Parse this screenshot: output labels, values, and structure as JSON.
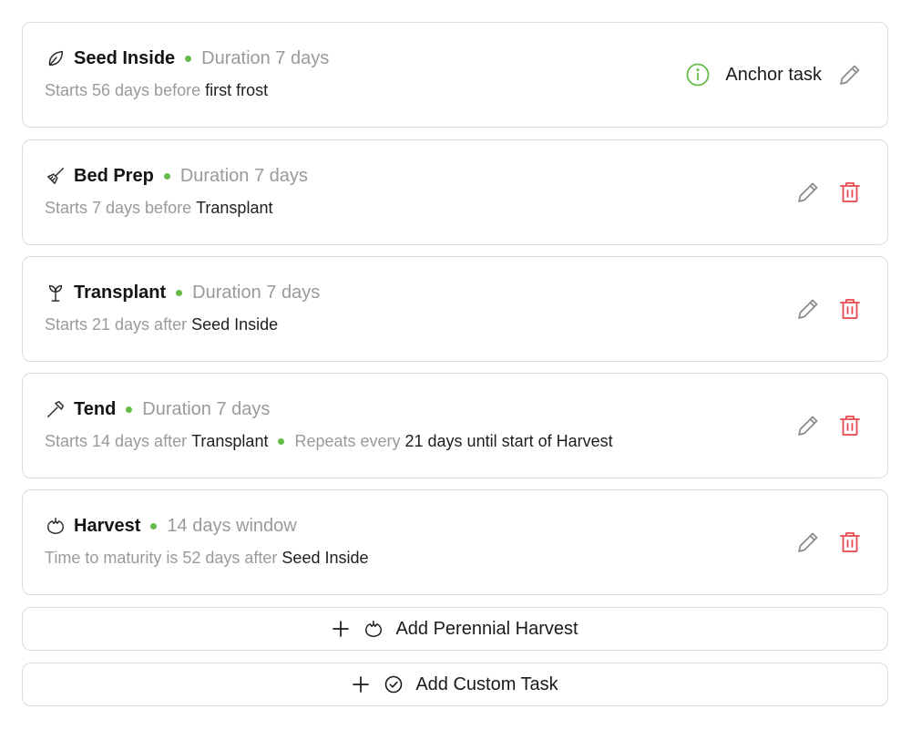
{
  "tasks": [
    {
      "icon": "leaf-icon",
      "name": "Seed Inside",
      "duration": "Duration 7 days",
      "sub_prefix": "Starts 56 days before",
      "sub_ref": "first frost",
      "anchor": true,
      "anchor_label": "Anchor task"
    },
    {
      "icon": "broom-icon",
      "name": "Bed Prep",
      "duration": "Duration 7 days",
      "sub_prefix": "Starts 7 days before",
      "sub_ref": "Transplant"
    },
    {
      "icon": "sprout-icon",
      "name": "Transplant",
      "duration": "Duration 7 days",
      "sub_prefix": "Starts 21 days after",
      "sub_ref": "Seed Inside"
    },
    {
      "icon": "hoe-icon",
      "name": "Tend",
      "duration": "Duration 7 days",
      "sub_prefix": "Starts 14 days after",
      "sub_ref": "Transplant",
      "repeat_prefix": "Repeats every",
      "repeat_ref": "21 days until start of Harvest"
    },
    {
      "icon": "tomato-icon",
      "name": "Harvest",
      "duration": "14 days window",
      "sub_prefix": "Time to maturity is 52 days after",
      "sub_ref": "Seed Inside"
    }
  ],
  "buttons": {
    "add_perennial_harvest": "Add Perennial Harvest",
    "add_custom_task": "Add Custom Task"
  },
  "colors": {
    "accent_green": "#65bb47",
    "delete_red": "#e5484d",
    "muted_text": "#9a9a9a",
    "border": "#dcdcdc"
  }
}
